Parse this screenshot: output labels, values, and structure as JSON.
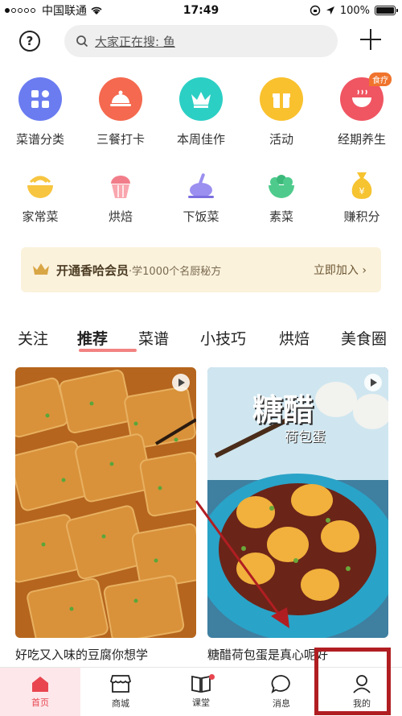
{
  "status_bar": {
    "carrier": "中国联通",
    "time": "17:49",
    "battery": "100%"
  },
  "search": {
    "placeholder": "大家正在搜: 鱼"
  },
  "categories_row1": [
    {
      "label": "菜谱分类",
      "icon": "grid-icon",
      "color": "#6b7cf0"
    },
    {
      "label": "三餐打卡",
      "icon": "dish-cover-icon",
      "color": "#f4694f"
    },
    {
      "label": "本周佳作",
      "icon": "crown-icon",
      "color": "#2ccfc4"
    },
    {
      "label": "活动",
      "icon": "gift-icon",
      "color": "#f9c12e"
    },
    {
      "label": "经期养生",
      "icon": "bowl-icon",
      "color": "#f05562",
      "badge": "食疗"
    }
  ],
  "categories_row2": [
    {
      "label": "家常菜",
      "icon": "noodle-bowl-icon",
      "color": "#f7c540"
    },
    {
      "label": "烘焙",
      "icon": "cupcake-icon",
      "color": "#f27d8a"
    },
    {
      "label": "下饭菜",
      "icon": "chicken-leg-icon",
      "color": "#9b8ff0"
    },
    {
      "label": "素菜",
      "icon": "salad-icon",
      "color": "#4ecb8c"
    },
    {
      "label": "赚积分",
      "icon": "coin-bag-icon",
      "color": "#f6c331"
    }
  ],
  "banner": {
    "title": "开通香哈会员",
    "desc": "·学1000个名厨秘方",
    "action": "立即加入 ›"
  },
  "tabs": [
    "关注",
    "推荐",
    "菜谱",
    "小技巧",
    "烘焙",
    "美食圈"
  ],
  "active_tab": "推荐",
  "feed": [
    {
      "title": "好吃又入味的豆腐你想学"
    },
    {
      "title": "糖醋荷包蛋是真心呢好",
      "overlay_title": "糖醋",
      "overlay_sub": "荷包蛋"
    }
  ],
  "tabbar": [
    {
      "label": "首页",
      "icon": "home-icon"
    },
    {
      "label": "商城",
      "icon": "shop-icon"
    },
    {
      "label": "课堂",
      "icon": "book-icon"
    },
    {
      "label": "消息",
      "icon": "chat-bubble-icon"
    },
    {
      "label": "我的",
      "icon": "person-icon"
    }
  ],
  "colors": {
    "accent": "#e8454f",
    "annotation": "#b01e22",
    "banner_bg": "#fbf2dc"
  }
}
